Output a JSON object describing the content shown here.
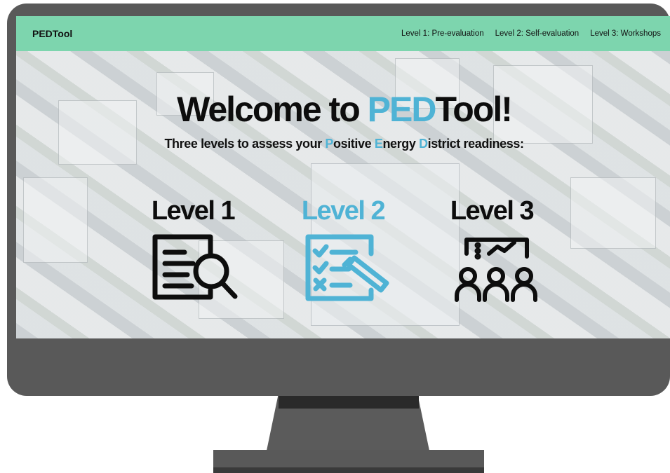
{
  "navbar": {
    "brand": "PEDTool",
    "links": [
      "Level 1: Pre-evaluation",
      "Level 2: Self-evaluation",
      "Level 3: Workshops"
    ]
  },
  "hero": {
    "title_prefix": "Welcome to ",
    "title_accent": "PED",
    "title_suffix": "Tool!",
    "subtitle": {
      "part1": "Three levels to assess your ",
      "p": "P",
      "part2": "ositive ",
      "e": "E",
      "part3": "nergy ",
      "d": "D",
      "part4": "istrict readiness:"
    }
  },
  "levels": [
    {
      "label": "Level 1",
      "icon": "document-search-icon"
    },
    {
      "label": "Level 2",
      "icon": "checklist-pencil-icon"
    },
    {
      "label": "Level 3",
      "icon": "presentation-group-icon"
    }
  ],
  "colors": {
    "navbar": "#7dd5ae",
    "accent": "#4fb3d5",
    "monitor": "#595959"
  }
}
